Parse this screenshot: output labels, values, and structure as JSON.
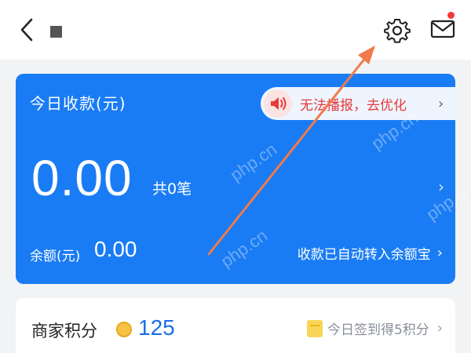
{
  "header": {
    "back_icon": "chevron-left-icon",
    "settings_icon": "gear-icon",
    "mail_icon": "mail-icon",
    "mail_has_unread": true
  },
  "income_card": {
    "title": "今日收款(元)",
    "broadcast_notice": "无法播报，去优化",
    "broadcast_icon": "speaker-icon",
    "amount": "0.00",
    "transaction_count": "共0笔",
    "balance_label": "余额(元)",
    "balance_value": "0.00",
    "auto_transfer_text": "收款已自动转入余额宝",
    "card_color": "#1a7cf4",
    "notice_color": "#e83a3a"
  },
  "points": {
    "label": "商家积分",
    "value": "125",
    "checkin_text": "今日签到得5积分",
    "value_color": "#1a6fe6"
  },
  "watermark": "php.cn",
  "annotation_color": "#f07a4a"
}
